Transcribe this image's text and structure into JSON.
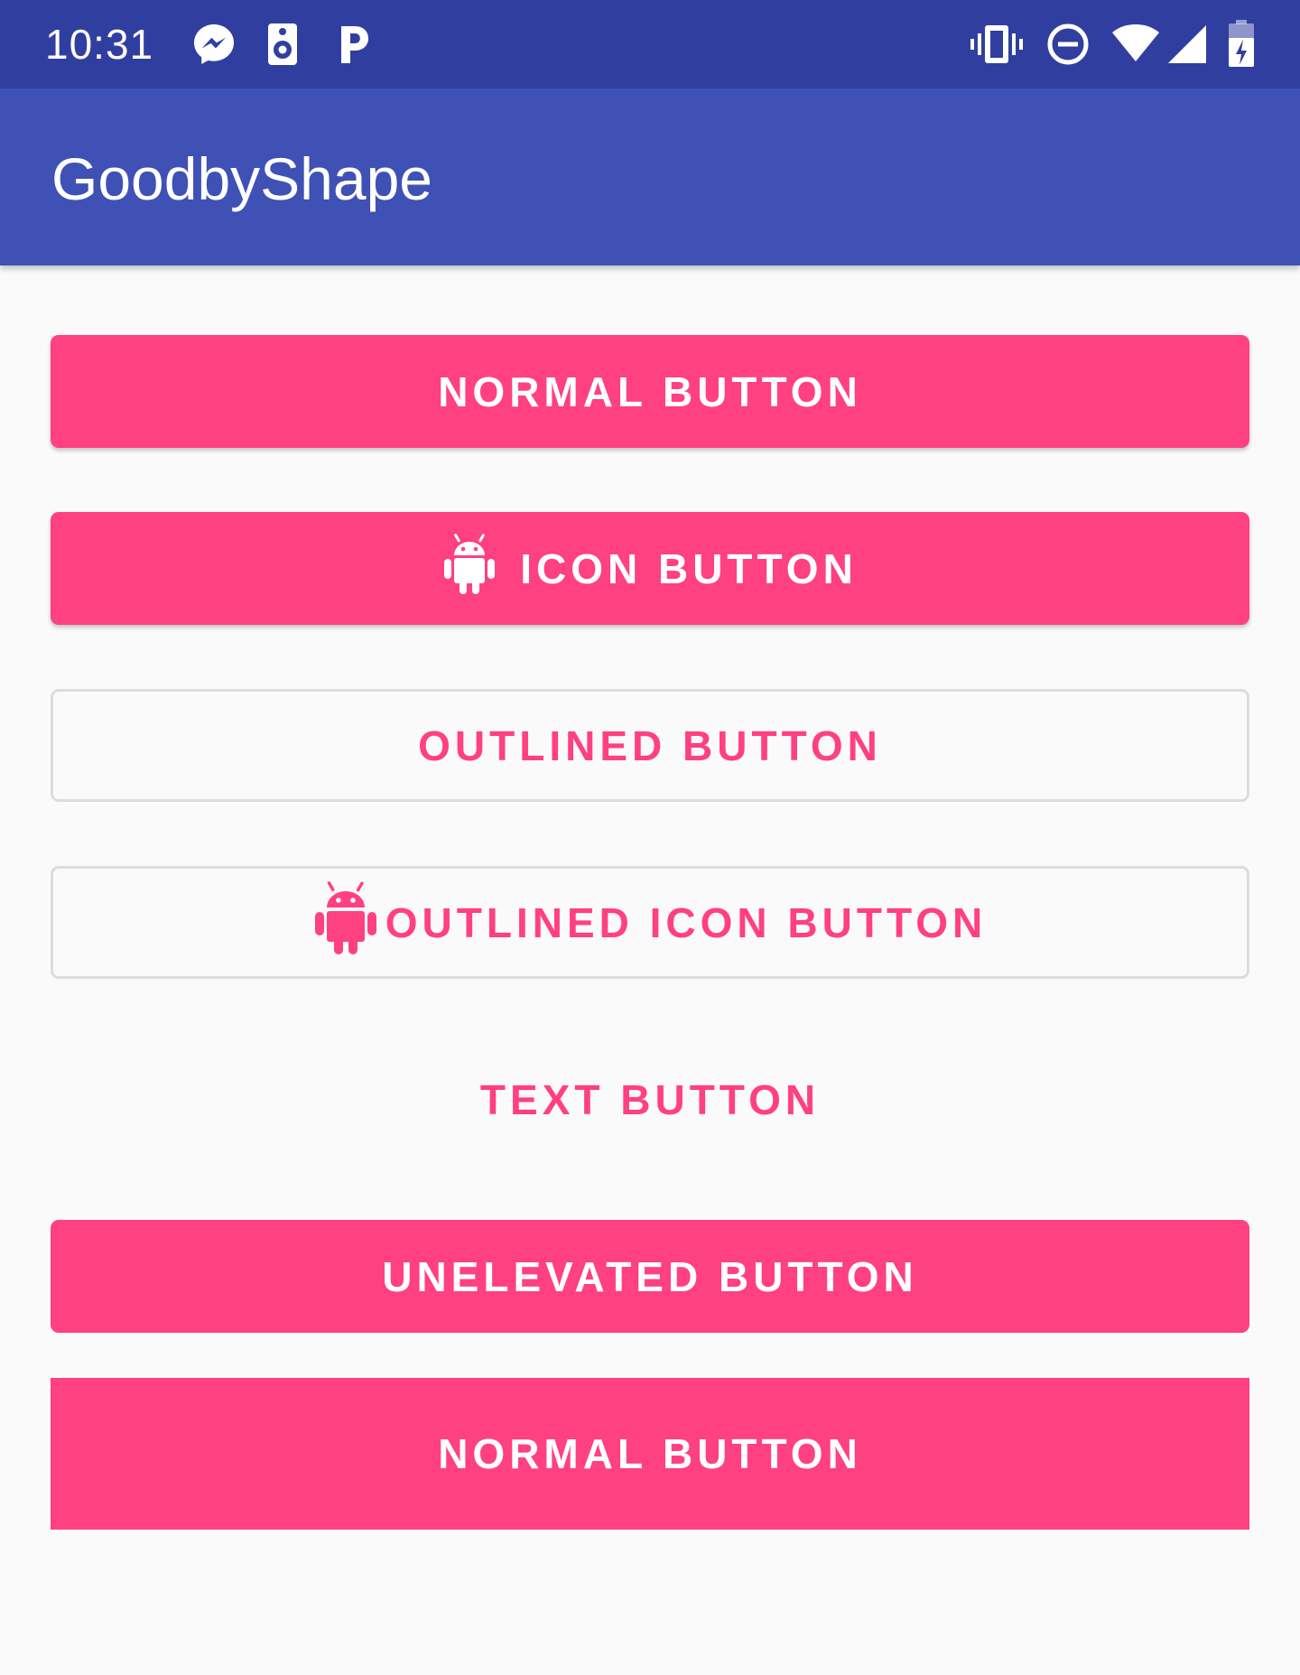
{
  "status_bar": {
    "time": "10:31",
    "notification_icons": [
      "messenger-icon",
      "speaker-icon",
      "p-icon"
    ],
    "system_icons": [
      "vibrate-icon",
      "do-not-disturb-icon",
      "wifi-icon",
      "cell-signal-icon",
      "battery-charging-icon"
    ]
  },
  "app_bar": {
    "title": "GoodbyShape"
  },
  "buttons": {
    "normal": "NORMAL BUTTON",
    "icon": "ICON BUTTON",
    "outlined": "OUTLINED BUTTON",
    "outlined_icon": "OUTLINED ICON BUTTON",
    "text": "TEXT BUTTON",
    "unelevated": "UNELEVATED BUTTON",
    "normal_square": "NORMAL BUTTON"
  },
  "colors": {
    "status_bar": "#303f9f",
    "app_bar": "#3f51b5",
    "accent": "#ff4081",
    "background": "#fafafa",
    "outline": "#dcdcdc"
  }
}
